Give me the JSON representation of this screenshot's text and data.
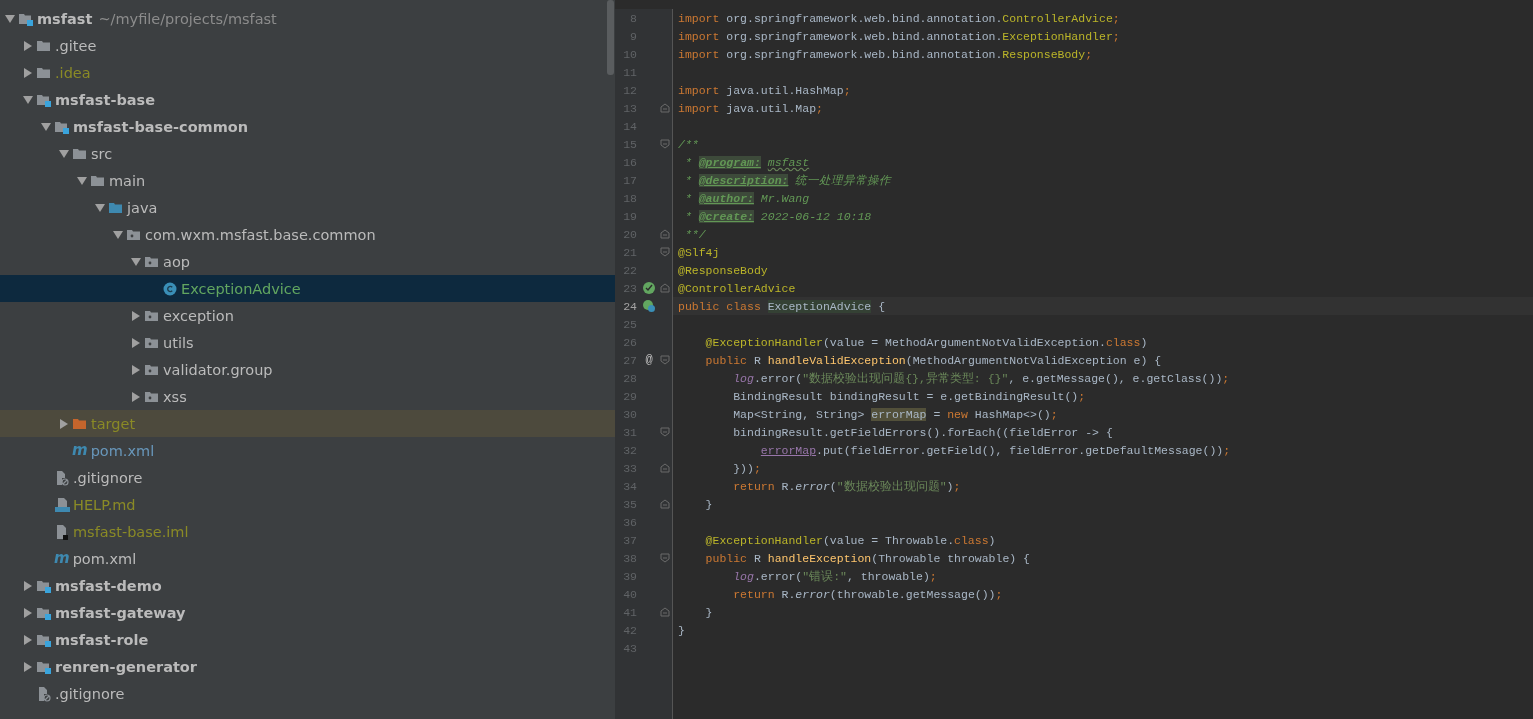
{
  "project_tree": {
    "nodes": [
      {
        "label": "msfast",
        "path": "~/myfile/projects/msfast",
        "kind": "module",
        "expanded": true,
        "selected": false,
        "children": [
          {
            "label": ".gitee",
            "kind": "folder",
            "expanded": false,
            "selected": false
          },
          {
            "label": ".idea",
            "kind": "folder",
            "color": "#8a8a26",
            "expanded": false,
            "selected": false
          },
          {
            "label": "msfast-base",
            "kind": "module",
            "expanded": true,
            "selected": false,
            "children": [
              {
                "label": "msfast-base-common",
                "kind": "module",
                "expanded": true,
                "selected": false,
                "children": [
                  {
                    "label": "src",
                    "kind": "folder",
                    "expanded": true,
                    "selected": false,
                    "children": [
                      {
                        "label": "main",
                        "kind": "folder",
                        "expanded": true,
                        "selected": false,
                        "children": [
                          {
                            "label": "java",
                            "kind": "source-folder",
                            "expanded": true,
                            "selected": false,
                            "children": [
                              {
                                "label": "com.wxm.msfast.base.common",
                                "kind": "package",
                                "expanded": true,
                                "selected": false,
                                "children": [
                                  {
                                    "label": "aop",
                                    "kind": "package",
                                    "expanded": true,
                                    "selected": false,
                                    "children": [
                                      {
                                        "label": "ExceptionAdvice",
                                        "kind": "class",
                                        "color": "#62a660",
                                        "selected": true
                                      }
                                    ]
                                  },
                                  {
                                    "label": "exception",
                                    "kind": "package",
                                    "expanded": false,
                                    "selected": false
                                  },
                                  {
                                    "label": "utils",
                                    "kind": "package",
                                    "expanded": false,
                                    "selected": false
                                  },
                                  {
                                    "label": "validator.group",
                                    "kind": "package",
                                    "expanded": false,
                                    "selected": false
                                  },
                                  {
                                    "label": "xss",
                                    "kind": "package",
                                    "expanded": false,
                                    "selected": false
                                  }
                                ]
                              }
                            ]
                          }
                        ]
                      }
                    ]
                  },
                  {
                    "label": "target",
                    "kind": "excluded-folder",
                    "color": "#8a8a26",
                    "expanded": false,
                    "selected": false
                  },
                  {
                    "label": "pom.xml",
                    "kind": "maven",
                    "icon_label": "m",
                    "color": "#6897bb",
                    "selected": false
                  }
                ]
              },
              {
                "label": ".gitignore",
                "kind": "ignore-file",
                "selected": false
              },
              {
                "label": "HELP.md",
                "kind": "markdown",
                "color": "#8a8a26",
                "selected": false
              },
              {
                "label": "msfast-base.iml",
                "kind": "iml",
                "color": "#8a8a26",
                "selected": false
              },
              {
                "label": "pom.xml",
                "kind": "maven",
                "icon_label": "m",
                "selected": false
              }
            ]
          },
          {
            "label": "msfast-demo",
            "kind": "module",
            "expanded": false,
            "selected": false
          },
          {
            "label": "msfast-gateway",
            "kind": "module",
            "expanded": false,
            "selected": false
          },
          {
            "label": "msfast-role",
            "kind": "module",
            "expanded": false,
            "selected": false
          },
          {
            "label": "renren-generator",
            "kind": "module",
            "expanded": false,
            "selected": false
          },
          {
            "label": ".gitignore",
            "kind": "ignore-file",
            "selected": false
          }
        ]
      }
    ]
  },
  "editor": {
    "lines": [
      {
        "number": "8",
        "tokens": [
          {
            "kind": "kw",
            "s": "import "
          },
          {
            "kind": "txt",
            "s": "org.springframework.web.bind.annotation."
          },
          {
            "kind": "ann",
            "s": "ControllerAdvice"
          },
          {
            "kind": "kw",
            "s": ";"
          }
        ]
      },
      {
        "number": "9",
        "tokens": [
          {
            "kind": "kw",
            "s": "import "
          },
          {
            "kind": "txt",
            "s": "org.springframework.web.bind.annotation."
          },
          {
            "kind": "ann",
            "s": "ExceptionHandler"
          },
          {
            "kind": "kw",
            "s": ";"
          }
        ]
      },
      {
        "number": "10",
        "tokens": [
          {
            "kind": "kw",
            "s": "import "
          },
          {
            "kind": "txt",
            "s": "org.springframework.web.bind.annotation."
          },
          {
            "kind": "ann",
            "s": "ResponseBody"
          },
          {
            "kind": "kw",
            "s": ";"
          }
        ]
      },
      {
        "number": "11"
      },
      {
        "number": "12",
        "tokens": [
          {
            "kind": "kw",
            "s": "import "
          },
          {
            "kind": "txt",
            "s": "java.util.HashMap"
          },
          {
            "kind": "kw",
            "s": ";"
          }
        ]
      },
      {
        "number": "13",
        "markers": [
          {
            "kind": "fold-end"
          }
        ],
        "tokens": [
          {
            "kind": "kw",
            "s": "import "
          },
          {
            "kind": "txt",
            "s": "java.util.Map"
          },
          {
            "kind": "kw",
            "s": ";"
          }
        ]
      },
      {
        "number": "14"
      },
      {
        "number": "15",
        "markers": [
          {
            "kind": "fold-start"
          }
        ],
        "tokens": [
          {
            "kind": "doc",
            "s": "/**"
          }
        ]
      },
      {
        "number": "16",
        "tokens": [
          {
            "kind": "doc",
            "s": " * "
          },
          {
            "kind": "doctag",
            "s": "@program:"
          },
          {
            "kind": "typo",
            "s": " msfast"
          }
        ]
      },
      {
        "number": "17",
        "tokens": [
          {
            "kind": "doc",
            "s": " * "
          },
          {
            "kind": "doctag",
            "s": "@description:"
          },
          {
            "kind": "doc",
            "s": " 统一处理异常操作"
          }
        ]
      },
      {
        "number": "18",
        "tokens": [
          {
            "kind": "doc",
            "s": " * "
          },
          {
            "kind": "doctag",
            "s": "@author:"
          },
          {
            "kind": "doc",
            "s": " Mr.Wang"
          }
        ]
      },
      {
        "number": "19",
        "tokens": [
          {
            "kind": "doc",
            "s": " * "
          },
          {
            "kind": "doctag",
            "s": "@create:"
          },
          {
            "kind": "doc",
            "s": " 2022-06-12 10:18"
          }
        ]
      },
      {
        "number": "20",
        "markers": [
          {
            "kind": "fold-end"
          }
        ],
        "tokens": [
          {
            "kind": "doc",
            "s": " **/"
          }
        ]
      },
      {
        "number": "21",
        "markers": [
          {
            "kind": "fold-start"
          }
        ],
        "tokens": [
          {
            "kind": "ann",
            "s": "@Slf4j"
          }
        ]
      },
      {
        "number": "22",
        "tokens": [
          {
            "kind": "ann",
            "s": "@ResponseBody"
          }
        ]
      },
      {
        "number": "23",
        "markers": [
          {
            "kind": "bean"
          },
          {
            "kind": "fold-end"
          }
        ],
        "tokens": [
          {
            "kind": "ann",
            "s": "@ControllerAdvice"
          }
        ]
      },
      {
        "number": "24",
        "current": true,
        "markers": [
          {
            "kind": "class"
          }
        ],
        "tokens": [
          {
            "kind": "kw",
            "s": "public class "
          },
          {
            "kind": "hl",
            "s": "ExceptionAdvice"
          },
          {
            "kind": "txt",
            "s": " {"
          }
        ]
      },
      {
        "number": "25"
      },
      {
        "number": "26",
        "tokens": [
          {
            "kind": "ann",
            "s": "    @ExceptionHandler"
          },
          {
            "kind": "txt",
            "s": "(value = MethodArgumentNotValidException."
          },
          {
            "kind": "kw",
            "s": "class"
          },
          {
            "kind": "txt",
            "s": ")"
          }
        ]
      },
      {
        "number": "27",
        "markers": [
          {
            "kind": "fold-start"
          }
        ],
        "gutter_mark": "@",
        "tokens": [
          {
            "kind": "kw",
            "s": "    public "
          },
          {
            "kind": "txt",
            "s": "R "
          },
          {
            "kind": "fn",
            "s": "handleValidException"
          },
          {
            "kind": "txt",
            "s": "(MethodArgumentNotValidException e) {"
          }
        ]
      },
      {
        "number": "28",
        "tokens": [
          {
            "kind": "fld",
            "s": "        log"
          },
          {
            "kind": "txt",
            "s": ".error("
          },
          {
            "kind": "str",
            "s": "\"数据校验出现问题{},异常类型: {}\""
          },
          {
            "kind": "txt",
            "s": ", e.getMessage(), e.getClass())"
          },
          {
            "kind": "kw",
            "s": ";"
          }
        ]
      },
      {
        "number": "29",
        "tokens": [
          {
            "kind": "txt",
            "s": "        BindingResult bindingResult = e.getBindingResult()"
          },
          {
            "kind": "kw",
            "s": ";"
          }
        ]
      },
      {
        "number": "30",
        "tokens": [
          {
            "kind": "txt",
            "s": "        Map<String, String> "
          },
          {
            "kind": "hlvar",
            "s": "errorMap"
          },
          {
            "kind": "txt",
            "s": " = "
          },
          {
            "kind": "kw",
            "s": "new "
          },
          {
            "kind": "txt",
            "s": "HashMap<>()"
          },
          {
            "kind": "kw",
            "s": ";"
          }
        ]
      },
      {
        "number": "31",
        "markers": [
          {
            "kind": "fold-start"
          }
        ],
        "tokens": [
          {
            "kind": "txt",
            "s": "        bindingResult.getFieldErrors().forEach((fieldError -> {"
          }
        ]
      },
      {
        "number": "32",
        "tokens": [
          {
            "kind": "var",
            "s": "            errorMap"
          },
          {
            "kind": "txt",
            "s": ".put(fieldError.getField(), fieldError.getDefaultMessage())"
          },
          {
            "kind": "kw",
            "s": ";"
          }
        ]
      },
      {
        "number": "33",
        "markers": [
          {
            "kind": "fold-end"
          }
        ],
        "tokens": [
          {
            "kind": "txt",
            "s": "        }))"
          },
          {
            "kind": "kw",
            "s": ";"
          }
        ]
      },
      {
        "number": "34",
        "tokens": [
          {
            "kind": "kw",
            "s": "        return "
          },
          {
            "kind": "txt",
            "s": "R."
          },
          {
            "kind": "ital",
            "s": "error"
          },
          {
            "kind": "txt",
            "s": "("
          },
          {
            "kind": "str",
            "s": "\"数据校验出现问题\""
          },
          {
            "kind": "txt",
            "s": ")"
          },
          {
            "kind": "kw",
            "s": ";"
          }
        ]
      },
      {
        "number": "35",
        "markers": [
          {
            "kind": "fold-end"
          }
        ],
        "tokens": [
          {
            "kind": "txt",
            "s": "    }"
          }
        ]
      },
      {
        "number": "36"
      },
      {
        "number": "37",
        "tokens": [
          {
            "kind": "ann",
            "s": "    @ExceptionHandler"
          },
          {
            "kind": "txt",
            "s": "(value = Throwable."
          },
          {
            "kind": "kw",
            "s": "class"
          },
          {
            "kind": "txt",
            "s": ")"
          }
        ]
      },
      {
        "number": "38",
        "markers": [
          {
            "kind": "fold-start"
          }
        ],
        "tokens": [
          {
            "kind": "kw",
            "s": "    public "
          },
          {
            "kind": "txt",
            "s": "R "
          },
          {
            "kind": "fn",
            "s": "handleException"
          },
          {
            "kind": "txt",
            "s": "(Throwable throwable) {"
          }
        ]
      },
      {
        "number": "39",
        "tokens": [
          {
            "kind": "fld",
            "s": "        log"
          },
          {
            "kind": "txt",
            "s": ".error("
          },
          {
            "kind": "str",
            "s": "\"错误:\""
          },
          {
            "kind": "txt",
            "s": ", throwable)"
          },
          {
            "kind": "kw",
            "s": ";"
          }
        ]
      },
      {
        "number": "40",
        "tokens": [
          {
            "kind": "kw",
            "s": "        return "
          },
          {
            "kind": "txt",
            "s": "R."
          },
          {
            "kind": "ital",
            "s": "error"
          },
          {
            "kind": "txt",
            "s": "(throwable.getMessage())"
          },
          {
            "kind": "kw",
            "s": ";"
          }
        ]
      },
      {
        "number": "41",
        "markers": [
          {
            "kind": "fold-end"
          }
        ],
        "tokens": [
          {
            "kind": "txt",
            "s": "    }"
          }
        ]
      },
      {
        "number": "42",
        "tokens": [
          {
            "kind": "txt",
            "s": "}"
          }
        ]
      },
      {
        "number": "43"
      }
    ]
  }
}
